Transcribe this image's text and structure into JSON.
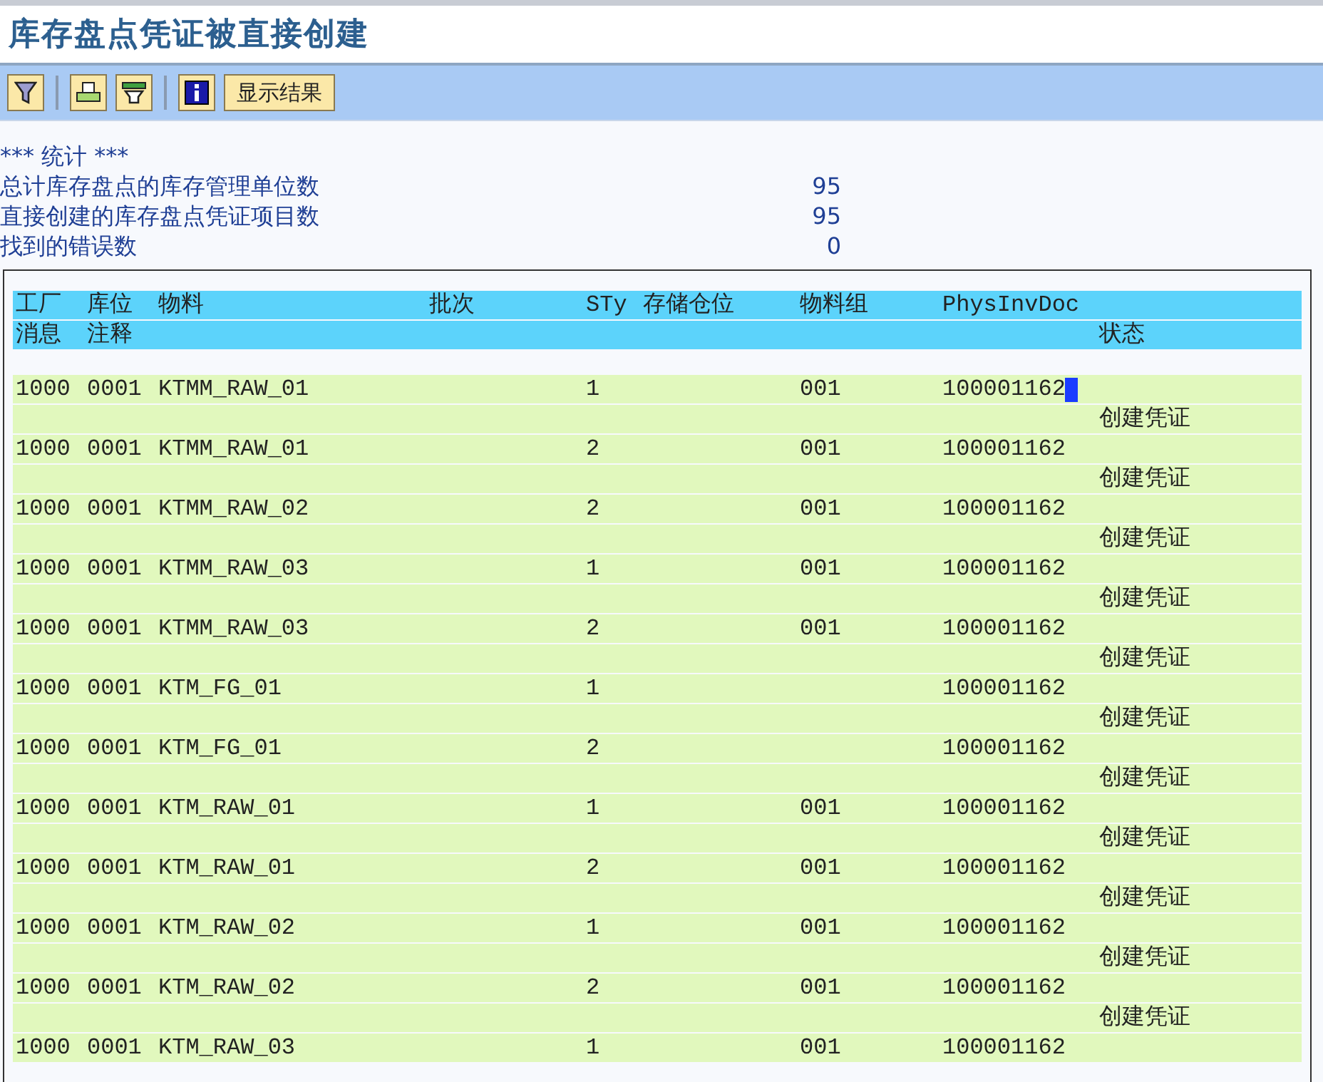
{
  "title": "库存盘点凭证被直接创建",
  "toolbar": {
    "items": [
      {
        "kind": "filter"
      },
      {
        "kind": "separator"
      },
      {
        "kind": "print"
      },
      {
        "kind": "layout"
      },
      {
        "kind": "separator"
      },
      {
        "kind": "info"
      },
      {
        "kind": "text",
        "label": "显示结果"
      }
    ]
  },
  "statistics": {
    "heading": "*** 统计 ***",
    "lines": [
      {
        "label": "总计库存盘点的库存管理单位数",
        "value": "95"
      },
      {
        "label": "直接创建的库存盘点凭证项目数",
        "value": "95"
      },
      {
        "label": "找到的错误数",
        "value": "0"
      }
    ]
  },
  "table": {
    "header_line_1": [
      "工厂",
      "库位",
      "物料",
      "批次",
      "STy",
      "存储仓位",
      "物料组",
      "PhysInvDoc"
    ],
    "header_line_2": [
      "消息",
      "注释",
      "状态"
    ],
    "rows": [
      {
        "plant": "1000",
        "sloc": "0001",
        "material": "KTMM_RAW_01",
        "sty": "1",
        "matgroup": "001",
        "doc": "100001162",
        "status": "创建凭证",
        "cursor": true
      },
      {
        "plant": "1000",
        "sloc": "0001",
        "material": "KTMM_RAW_01",
        "sty": "2",
        "matgroup": "001",
        "doc": "100001162",
        "status": "创建凭证",
        "cursor": false
      },
      {
        "plant": "1000",
        "sloc": "0001",
        "material": "KTMM_RAW_02",
        "sty": "2",
        "matgroup": "001",
        "doc": "100001162",
        "status": "创建凭证",
        "cursor": false
      },
      {
        "plant": "1000",
        "sloc": "0001",
        "material": "KTMM_RAW_03",
        "sty": "1",
        "matgroup": "001",
        "doc": "100001162",
        "status": "创建凭证",
        "cursor": false
      },
      {
        "plant": "1000",
        "sloc": "0001",
        "material": "KTMM_RAW_03",
        "sty": "2",
        "matgroup": "001",
        "doc": "100001162",
        "status": "创建凭证",
        "cursor": false
      },
      {
        "plant": "1000",
        "sloc": "0001",
        "material": "KTM_FG_01",
        "sty": "1",
        "doc": "100001162",
        "status": "创建凭证",
        "cursor": false
      },
      {
        "plant": "1000",
        "sloc": "0001",
        "material": "KTM_FG_01",
        "sty": "2",
        "doc": "100001162",
        "status": "创建凭证",
        "cursor": false
      },
      {
        "plant": "1000",
        "sloc": "0001",
        "material": "KTM_RAW_01",
        "sty": "1",
        "matgroup": "001",
        "doc": "100001162",
        "status": "创建凭证",
        "cursor": false
      },
      {
        "plant": "1000",
        "sloc": "0001",
        "material": "KTM_RAW_01",
        "sty": "2",
        "matgroup": "001",
        "doc": "100001162",
        "status": "创建凭证",
        "cursor": false
      },
      {
        "plant": "1000",
        "sloc": "0001",
        "material": "KTM_RAW_02",
        "sty": "1",
        "matgroup": "001",
        "doc": "100001162",
        "status": "创建凭证",
        "cursor": false
      },
      {
        "plant": "1000",
        "sloc": "0001",
        "material": "KTM_RAW_02",
        "sty": "2",
        "matgroup": "001",
        "doc": "100001162",
        "status": "创建凭证",
        "cursor": false
      },
      {
        "plant": "1000",
        "sloc": "0001",
        "material": "KTM_RAW_03",
        "sty": "1",
        "matgroup": "001",
        "doc": "100001162",
        "cursor": false
      }
    ]
  }
}
